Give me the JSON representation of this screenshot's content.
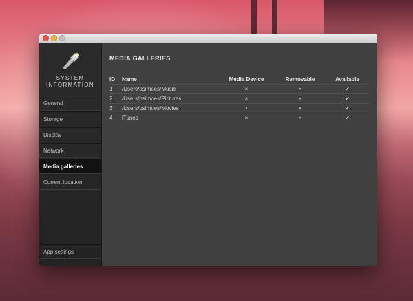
{
  "sidebar": {
    "brand_line1": "SYSTEM",
    "brand_line2": "INFORMATION",
    "brand_icon": "flashlight-icon",
    "items": [
      {
        "label": "General"
      },
      {
        "label": "Storage"
      },
      {
        "label": "Display"
      },
      {
        "label": "Network"
      },
      {
        "label": "Media galleries",
        "active": true
      },
      {
        "label": "Current location"
      }
    ],
    "settings_label": "App settings"
  },
  "main": {
    "title": "MEDIA GALLERIES",
    "columns": [
      "ID",
      "Name",
      "Media Device",
      "Removable",
      "Available"
    ],
    "rows": [
      {
        "id": "1",
        "name": "/Users/psimoes/Music",
        "media_device": "×",
        "removable": "×",
        "available": "✔"
      },
      {
        "id": "2",
        "name": "/Users/psimoes/Pictures",
        "media_device": "×",
        "removable": "×",
        "available": "✔"
      },
      {
        "id": "3",
        "name": "/Users/psimoes/Movies",
        "media_device": "×",
        "removable": "×",
        "available": "✔"
      },
      {
        "id": "4",
        "name": "iTunes",
        "media_device": "×",
        "removable": "×",
        "available": "✔"
      }
    ]
  },
  "colors": {
    "sidebar_bg": "#262626",
    "content_bg": "#404040",
    "active_item_bg": "#121212"
  }
}
